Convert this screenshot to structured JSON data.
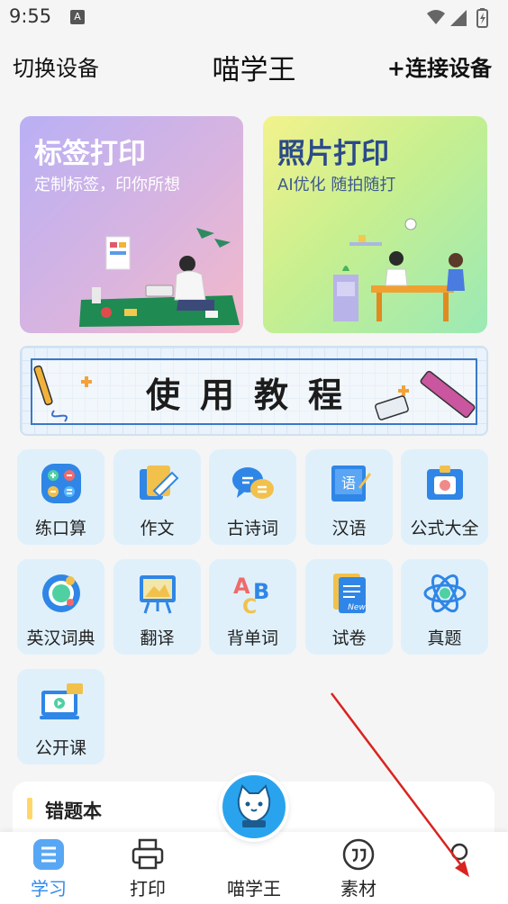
{
  "status": {
    "time": "9:55",
    "notif_badge": "A"
  },
  "topbar": {
    "switch_label": "切换设备",
    "title": "喵学王",
    "connect_label": "+连接设备"
  },
  "cards": {
    "label_print": {
      "title": "标签打印",
      "subtitle": "定制标签，印你所想"
    },
    "photo_print": {
      "title": "照片打印",
      "subtitle": "AI优化 随拍随打"
    }
  },
  "tutorial": {
    "text": "使用教程"
  },
  "grid": [
    {
      "label": "练口算",
      "icon": "calculator-icon"
    },
    {
      "label": "作文",
      "icon": "pen-notebook-icon"
    },
    {
      "label": "古诗词",
      "icon": "chat-bubbles-icon"
    },
    {
      "label": "汉语",
      "icon": "chinese-book-icon"
    },
    {
      "label": "公式大全",
      "icon": "id-card-icon"
    },
    {
      "label": "英汉词典",
      "icon": "dictionary-ring-icon"
    },
    {
      "label": "翻译",
      "icon": "easel-icon"
    },
    {
      "label": "背单词",
      "icon": "abc-icon"
    },
    {
      "label": "试卷",
      "icon": "exam-paper-icon"
    },
    {
      "label": "真题",
      "icon": "atom-icon"
    },
    {
      "label": "公开课",
      "icon": "video-laptop-icon"
    }
  ],
  "wrong_book": {
    "title": "错题本"
  },
  "nav": [
    {
      "label": "学习",
      "icon": "study-icon",
      "active": true
    },
    {
      "label": "打印",
      "icon": "printer-icon",
      "active": false
    },
    {
      "label": "喵学王",
      "icon": "cat-logo-icon",
      "active": false
    },
    {
      "label": "素材",
      "icon": "quote-icon",
      "active": false
    },
    {
      "label": "",
      "icon": "profile-icon",
      "active": false
    }
  ],
  "colors": {
    "accent": "#2e89f0",
    "tile_bg": "#dff0fb",
    "center_btn": "#2aa3ee"
  }
}
